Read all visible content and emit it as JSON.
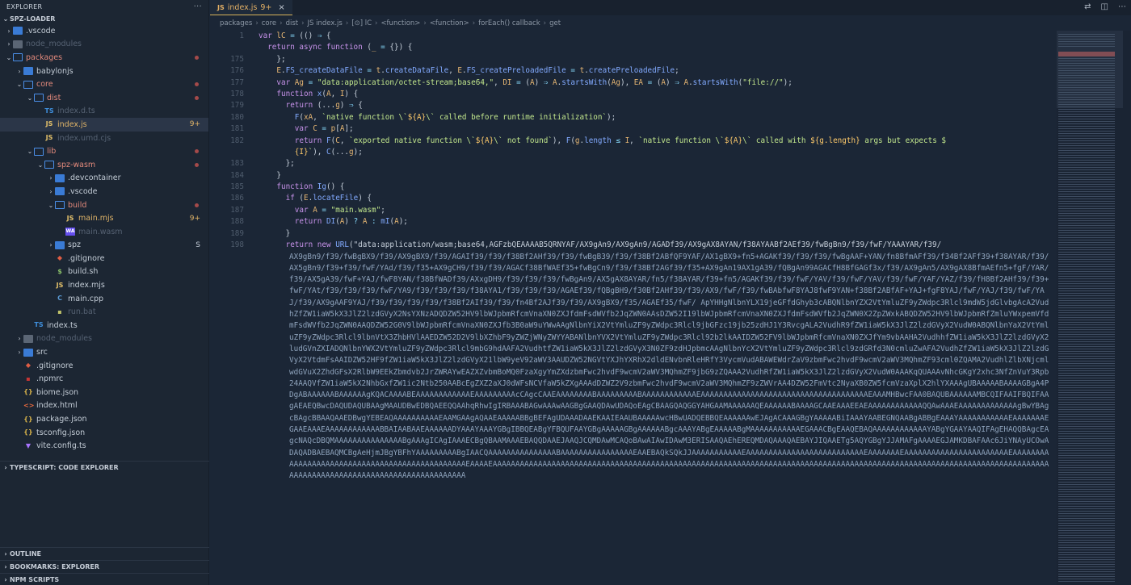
{
  "sidebar": {
    "title": "EXPLORER",
    "project": "SPZ-LOADER",
    "rows": [
      {
        "label": ".vscode",
        "icon": "folder",
        "depth": 0,
        "chev": "›",
        "state": ""
      },
      {
        "label": "node_modules",
        "icon": "folder-gray",
        "depth": 0,
        "chev": "›",
        "state": "dim"
      },
      {
        "label": "packages",
        "icon": "folder-open",
        "depth": 0,
        "chev": "⌄",
        "state": "mod",
        "dot": true
      },
      {
        "label": "babylonjs",
        "icon": "folder",
        "depth": 1,
        "chev": "›",
        "state": ""
      },
      {
        "label": "core",
        "icon": "folder-open",
        "depth": 1,
        "chev": "⌄",
        "state": "mod",
        "dot": true
      },
      {
        "label": "dist",
        "icon": "folder-open",
        "depth": 2,
        "chev": "⌄",
        "state": "mod",
        "dot": true
      },
      {
        "label": "index.d.ts",
        "icon": "ts",
        "depth": 3,
        "chev": "",
        "state": "dim"
      },
      {
        "label": "index.js",
        "icon": "js",
        "depth": 3,
        "chev": "",
        "state": "warn sel",
        "badge": "9+"
      },
      {
        "label": "index.umd.cjs",
        "icon": "js",
        "depth": 3,
        "chev": "",
        "state": "dim"
      },
      {
        "label": "lib",
        "icon": "folder-open",
        "depth": 2,
        "chev": "⌄",
        "state": "mod",
        "dot": true
      },
      {
        "label": "spz-wasm",
        "icon": "folder-open",
        "depth": 3,
        "chev": "⌄",
        "state": "mod",
        "dot": true
      },
      {
        "label": ".devcontainer",
        "icon": "folder",
        "depth": 4,
        "chev": "›",
        "state": ""
      },
      {
        "label": ".vscode",
        "icon": "folder",
        "depth": 4,
        "chev": "›",
        "state": ""
      },
      {
        "label": "build",
        "icon": "folder-open",
        "depth": 4,
        "chev": "⌄",
        "state": "mod",
        "dot": true
      },
      {
        "label": "main.mjs",
        "icon": "js",
        "depth": 5,
        "chev": "",
        "state": "warn",
        "badge": "9+"
      },
      {
        "label": "main.wasm",
        "icon": "wasm",
        "depth": 5,
        "chev": "",
        "state": "dim"
      },
      {
        "label": "spz",
        "icon": "folder",
        "depth": 4,
        "chev": "›",
        "state": "",
        "badge": "S"
      },
      {
        "label": ".gitignore",
        "icon": "git",
        "depth": 4,
        "chev": "",
        "state": ""
      },
      {
        "label": "build.sh",
        "icon": "sh",
        "depth": 4,
        "chev": "",
        "state": ""
      },
      {
        "label": "index.mjs",
        "icon": "js",
        "depth": 4,
        "chev": "",
        "state": ""
      },
      {
        "label": "main.cpp",
        "icon": "cpp",
        "depth": 4,
        "chev": "",
        "state": ""
      },
      {
        "label": "run.bat",
        "icon": "bat",
        "depth": 4,
        "chev": "",
        "state": "dim"
      },
      {
        "label": "index.ts",
        "icon": "ts",
        "depth": 2,
        "chev": "",
        "state": ""
      },
      {
        "label": "node_modules",
        "icon": "folder-gray",
        "depth": 1,
        "chev": "›",
        "state": "dim"
      },
      {
        "label": "src",
        "icon": "folder",
        "depth": 1,
        "chev": "›",
        "state": ""
      },
      {
        "label": ".gitignore",
        "icon": "git",
        "depth": 1,
        "chev": "",
        "state": ""
      },
      {
        "label": ".npmrc",
        "icon": "npm",
        "depth": 1,
        "chev": "",
        "state": ""
      },
      {
        "label": "biome.json",
        "icon": "biome",
        "depth": 1,
        "chev": "",
        "state": ""
      },
      {
        "label": "index.html",
        "icon": "html",
        "depth": 1,
        "chev": "",
        "state": ""
      },
      {
        "label": "package.json",
        "icon": "json",
        "depth": 1,
        "chev": "",
        "state": ""
      },
      {
        "label": "tsconfig.json",
        "icon": "json",
        "depth": 1,
        "chev": "",
        "state": ""
      },
      {
        "label": "vite.config.ts",
        "icon": "vite",
        "depth": 1,
        "chev": "",
        "state": ""
      }
    ],
    "sections": {
      "ts_explorer": "TYPESCRIPT: CODE EXPLORER",
      "outline": "OUTLINE",
      "bookmarks": "BOOKMARKS: EXPLORER",
      "npm": "NPM SCRIPTS"
    }
  },
  "tab": {
    "icon_text": "JS",
    "label": "index.js",
    "badge": "9+",
    "close": "×"
  },
  "breadcrumb": [
    "packages",
    "core",
    "dist",
    "JS index.js",
    "[⊙] lC",
    "<function>",
    "<function>",
    "forEach() callback",
    "get"
  ],
  "editor": {
    "lines": [
      {
        "n": "1",
        "html": "<span class='t-kw'>var</span> <span class='t-id'>lC</span> <span class='t-op'>=</span> (() <span class='t-op'>⇒</span> {"
      },
      {
        "n": "",
        "html": "  <span class='t-kw'>return async function</span> (<span class='t-id'>_</span> <span class='t-op'>=</span> {}) {"
      },
      {
        "n": "175",
        "html": "    };"
      },
      {
        "n": "176",
        "html": "    <span class='t-id'>E</span>.<span class='t-fn'>FS_createDataFile</span> <span class='t-op'>=</span> <span class='t-id'>t</span>.<span class='t-fn'>createDataFile</span>, <span class='t-id'>E</span>.<span class='t-fn'>FS_createPreloadedFile</span> <span class='t-op'>=</span> <span class='t-id'>t</span>.<span class='t-fn'>createPreloadedFile</span>;"
      },
      {
        "n": "177",
        "html": "    <span class='t-kw'>var</span> <span class='t-id'>Ag</span> <span class='t-op'>=</span> <span class='t-str'>\"data:application/octet-stream;base64,\"</span>, <span class='t-id'>DI</span> <span class='t-op'>=</span> (<span class='t-id'>A</span>) <span class='t-op'>⇒</span> <span class='t-id'>A</span>.<span class='t-fn'>startsWith</span>(<span class='t-id'>Ag</span>), <span class='t-id'>EA</span> <span class='t-op'>=</span> (<span class='t-id'>A</span>) <span class='t-op'>⇒</span> <span class='t-id'>A</span>.<span class='t-fn'>startsWith</span>(<span class='t-str'>\"file://\"</span>);"
      },
      {
        "n": "178",
        "html": "    <span class='t-kw'>function</span> <span class='t-fn'>x</span>(<span class='t-id'>A</span>, <span class='t-id'>I</span>) {"
      },
      {
        "n": "179",
        "html": "      <span class='t-kw'>return</span> (...<span class='t-id'>g</span>) <span class='t-op'>⇒</span> {"
      },
      {
        "n": "180",
        "html": "        <span class='t-fn'>F</span>(<span class='t-id'>xA</span>, <span class='t-str'>`native function \\`</span><span class='t-y'>${A}</span><span class='t-str'>\\` called before runtime initialization`</span>);"
      },
      {
        "n": "181",
        "html": "        <span class='t-kw'>var</span> <span class='t-id'>C</span> <span class='t-op'>=</span> <span class='t-id'>p</span>[<span class='t-id'>A</span>];"
      },
      {
        "n": "182",
        "html": "        <span class='t-kw'>return</span> <span class='t-fn'>F</span>(<span class='t-id'>C</span>, <span class='t-str'>`exported native function \\`</span><span class='t-y'>${A}</span><span class='t-str'>\\` not found`</span>), <span class='t-fn'>F</span>(<span class='t-id'>g</span>.<span class='t-fn'>length</span> <span class='t-op'>≤</span> <span class='t-id'>I</span>, <span class='t-str'>`native function \\`</span><span class='t-y'>${A}</span><span class='t-str'>\\` called with </span><span class='t-y'>${g.length}</span><span class='t-str'> args but expects $</span>"
      },
      {
        "n": "",
        "html": "        <span class='t-y'>{I}</span><span class='t-str'>`</span>), <span class='t-fn'>C</span>(...<span class='t-id'>g</span>);"
      },
      {
        "n": "183",
        "html": "      };"
      },
      {
        "n": "184",
        "html": "    }"
      },
      {
        "n": "185",
        "html": "    <span class='t-kw'>function</span> <span class='t-fn'>Ig</span>() {"
      },
      {
        "n": "186",
        "html": "      <span class='t-kw'>if</span> (<span class='t-id'>E</span>.<span class='t-fn'>locateFile</span>) {"
      },
      {
        "n": "187",
        "html": "        <span class='t-kw'>var</span> <span class='t-id'>A</span> <span class='t-op'>=</span> <span class='t-str'>\"main.wasm\"</span>;"
      },
      {
        "n": "188",
        "html": "        <span class='t-kw'>return</span> <span class='t-fn'>DI</span>(<span class='t-id'>A</span>) <span class='t-op'>?</span> <span class='t-id'>A</span> <span class='t-op'>:</span> <span class='t-fn'>mI</span>(<span class='t-id'>A</span>);"
      },
      {
        "n": "189",
        "html": "      }"
      },
      {
        "n": "198",
        "html": "      <span class='t-kw'>return new</span> <span class='t-fn'>URL</span>(\"data:application/wasm;base64,AGFzbQEAAAAB5QRNYAF/AX9gAn9/AX9gAn9/AGADf39/AX9gAX8AYAN/f38AYAABf2AEf39/fwBgBn9/f39/fwF/YAAAYAR/f39/"
      }
    ],
    "blob": "AX9gBn9/f39/fwBgBX9/f39/AX9gBX9/f39/AGAIf39/f39/f38Bf2AHf39/f39/fwBgB39/f39/f38Bf2ABfQF9YAF/AX1gBX9+fn5+AGAKf39/f39/f39/fwBgAAF+YAN/fn8BfmAFf39/f34Bf2AFf39+f38AYAR/f39/AX5gBn9/f39+f39/fwF/YAd/f39/f35+AX9gCH9/f39/f39/AGACf38BfWAEf35+fwBgCn9/f39/f38Bf2AGf39/f35+AX9gAn19AX1gA39/fQBgAn99AGACfH8BfGAGf3x/f39/AX9gAn5/AX9gAX8BfmAEfn5+fgF/YAR/f39/AX5gA39/fwF+YAJ/fwF8YAN/f38BfWADf39/AXxgDH9/f39/f39/f39/fwBgAn9/AX5gAX8AYAR/fn5/f38AYAR/f39+fn5/AGAKf39/f39/fwF/YAV/f39/fwF/YAV/f39/fwF/YAF/YAZ/f39/fH8Bf2AHf39/f39+fwF/YAt/f39/f39/f39/fwF/YA9/f39/f39/f39/f38AYA1/f39/f39/f39/AGAEf39/fQBgBH9/f30Bf2AHf39/f39/AX9/fwF/f39/fwBAbfwF8YAJ8fwF9YAN+f38Bf2ABfAF+YAJ+fgF8YAJ/fwF/YAJ/f39/fwF/YAJ/f39/AX9gAAF9YAJ/f39/f39/f39/f39/f38Bf2AIf39/f39/fn4Bf2AJf39/f39/AX9gBX9/f35/AGAEf35/fwF/ ApYHHgNlbnYLX19jeGFfdGhyb3cABQNlbnYZX2VtYmluZF9yZWdpc3Rlcl9mdW5jdGlvbgAcA2VudhZfZW1iaW5kX3JlZ2lzdGVyX2NsYXNzADQDZW52HV9lbWJpbmRfcmVnaXN0ZXJfdmFsdWVfb2JqZWN0AAsDZW52I19lbWJpbmRfcmVnaXN0ZXJfdmFsdWVfb2JqZWN0X2ZpZWxkABQDZW52HV9lbWJpbmRfZmluYWxpemVfdmFsdWVfb2JqZWN0AAQDZW52G0V9lbWJpbmRfcmVnaXN0ZXJfb3B0aW9uYWwAAgNlbnYiX2VtYmluZF9yZWdpc3Rlcl9jbGFzc19jb25zdHJ1Y3RvcgALA2VudhR9fZW1iaW5kX3JlZ2lzdGVyX2VudW0ABQNlbnYaX2VtYmluZF9yZWdpc3Rlcl9lbnVtX3ZhbHVlAAEDZW52D2V9lbXZhbF9yZWZjWNyZWYYABANlbnYVX2VtYmluZF9yZWdpc3Rlcl92b2lkAAIDZW52FV9lbWJpbmRfcmVnaXN0ZXJfYm9vbAAHA2VudhhfZW1iaW5kX3JlZ2lzdGVyX2ludGVnZXIADQNlbnYWX2VtYmluZF9yZWdpc3Rlcl9mbG9hdAAFA2VudhtfZW1iaW5kX3JlZ2lzdGVyX3N0ZF9zdHJpbmcAAgNlbnYcX2VtYmluZF9yZWdpc3Rlcl9zdGRfd3N0cmluZwAFA2VudhZfZW1iaW5kX3JlZ2lzdGVyX2VtdmFsAAIDZW52HF9fZW1iaW5kX3JlZ2lzdGVyX21lbW9yeV92aWV3AAUDZW52NGVtYXJhYXRhX2dldENvbnRleHRfY3VycmVudABAWEWdrZaV9zbmFwc2hvdF9wcmV2aWV3MQhmZF93cml0ZQAMA2VudhlZlbXNjcmlwdGVuX2ZhdGFsX2RlbW9EEkZbmdvb2JrZWRAYwEAZXZvbmBoMQ0FzaXgyYmZXdzbmFwc2hvdF9wcmV2aWV3MQhmZF9jbG9zZQAAA2VudhRfZW1iaW5kX3JlZ2lzdGVyX2VudW0AAAKqQUAAAvNhcGKgY2xhc3NfZnVuY3Rpb24AAQVfZW1iaW5kX2NhbGxfZW1ic2Ntb250AABcEgZXZ2aXJ0dWFsNCVfaW5kZXgAAAdDZWZ2V9zbmFwc2hvdF9wcmV2aWV3MQhmZF9zZWVrAA4DZW52FmVtc2NyaXB0ZW5fcmVzaXplX2hlYXAAAgUBAAAAABAAAAGBgA4PDgABAAAAAABAAAAAAgKQACAAAABEAAAAAAAAAAAAEAAAAAAAAAcCAgcCAAEAAAAAAAABAAAAAAAAABAAAAAAAAAAAAEAAAAAAAAAAAAAAAAAAAAAAAAAAAAAAAAAAAAAEAAAMHBwcFAA0BAQUBAAAAAAMBCQIFAAIFBQIFAAgAEAEQBwcDAQUDAQUBAAgMAAUDBwEDBQAEEQQAAhqRhwIgIRBAAABAGwAAAwAAGBgGAAQDAwUDAQoEAgCBAAGQAQGGYAHGAAMAAAAAAQEAAAAAABAAAAGCAAEAAAEEAEAAAAAAAAAAAAQQAwAAAEAAAAAAAAAAAAAgBwYBAgcBAgcBBAAQAAEDBwgYEBEAQAAAAAAAAAAEAAMGAAgAQAAEAAAAABBgBEFAgUDAAADAAEKAAIEAAUBAAAAAwcHBwUADQEBBQEAAAAAAwEJAgACAAAGBgYAAAAABiIAAAYAABEGNQAABgABBgEAAAYAAAAAAAAAAAEAAAAAAAEGAAEAAAEAAAAAAAAAAAABBAIAABAAEAAAAAADYAAAYAAAYGBgIBBQEABgYFBQUFAAYGBgAAAAAGBgAAAAAABgcAAAYABgEAAAAABgMAAAAAAAAAAAEGAAACBgEAAQEBAQAAAAAAAAAAAAYABgYGAAYAAQIFAgEHAQQBAgcEAgcNAQcDBQMAAAAAAAAAAAAAAABgAAAgICAgIAAAECBgQBAAMAAAEBAQQDAAEJAAQJCQMDAwMCAQoBAwAIAwIDAwM3ERISAAQAEhEREQMDAQAAAQAEBAYJIQAAETg5AQYGBgYJJAMAFgAAAAEGJAMKDBAFAAc6JiYNAyUCOwADAQADBAEBAQMCBgAeHjmJBgYBFhYAAAAAAAAABgIAACQAAAAAAAAAAAAAAABAAAAAAAAAAAAAAAAEAAEBAQkSQkJJAAAAAAAAAAAEAAAAAAAAAAAAAAAAAAAAAAAAAAEAAAAAAAEAAAAAAAAAAAAAAAAAAAAAAAEAAAAAAAAAAAAAAAAAAAAAAAAAAAAAAAAAAAAAAAAAAAAAAAEAAAAEAAAAAAAAAAAAAAAAAAAAAAAAAAAAAAAAAAAAAAAAAAAAAAAAAAAAAAAAAAAAAAAAAAAAAAAAAAAAAAAAAAAAAAAAAAAAAAAAAAAAAAAAAAAAAAAAAAAAAAAAAAAAAAAAAAAAAAAAAAAAAAAAAAAAAAAAAAAAAAAAAA"
  },
  "minimap": {
    "slider_top": 0
  },
  "tab_actions": [
    "⇄",
    "◫",
    "⋯"
  ]
}
